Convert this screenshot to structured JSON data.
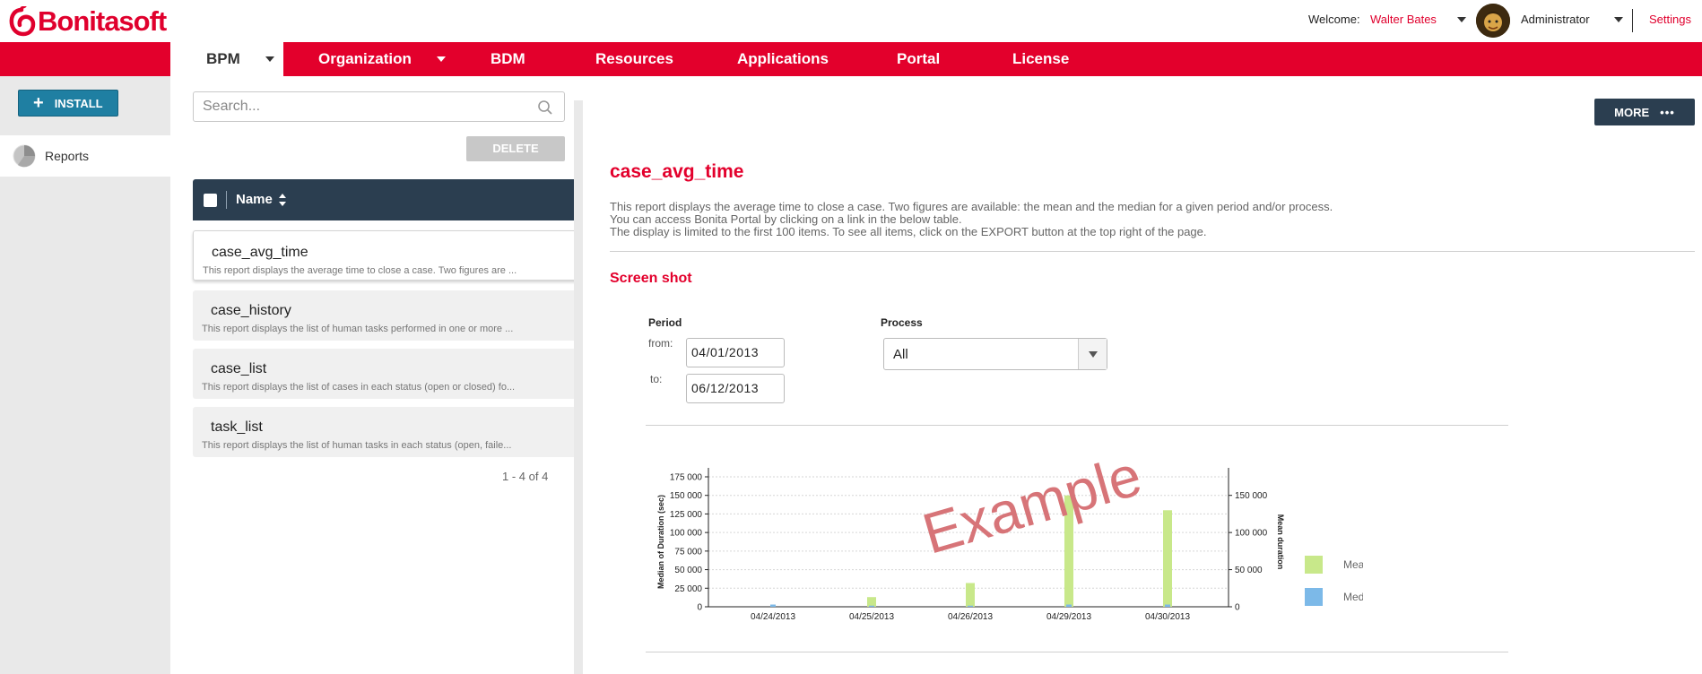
{
  "header": {
    "brand": "Bonitasoft",
    "welcome_label": "Welcome:",
    "user_name": "Walter Bates",
    "profile": "Administrator",
    "settings": "Settings"
  },
  "nav": {
    "items": [
      {
        "label": "BPM",
        "active": true,
        "dropdown": true
      },
      {
        "label": "Organization",
        "dropdown": true
      },
      {
        "label": "BDM"
      },
      {
        "label": "Resources"
      },
      {
        "label": "Applications"
      },
      {
        "label": "Portal"
      },
      {
        "label": "License"
      }
    ]
  },
  "sidebar": {
    "install_label": "INSTALL",
    "items": [
      {
        "label": "Reports",
        "icon": "pie-chart-icon"
      }
    ]
  },
  "list": {
    "search_placeholder": "Search...",
    "delete_label": "DELETE",
    "column_name": "Name",
    "rows": [
      {
        "title": "case_avg_time",
        "desc": "This report displays the average time to close a case. Two figures are ..."
      },
      {
        "title": "case_history",
        "desc": "This report displays the list of human tasks performed in one or more ..."
      },
      {
        "title": "case_list",
        "desc": "This report displays the list of cases in each status (open or closed) fo..."
      },
      {
        "title": "task_list",
        "desc": "This report displays the list of human tasks in each status (open, faile..."
      }
    ],
    "pager": "1 - 4 of 4"
  },
  "detail": {
    "more_label": "MORE",
    "title": "case_avg_time",
    "desc_lines": [
      "This report displays the average time to close a case. Two figures are available: the mean and the median for a given period and/or process.",
      "You can access Bonita Portal by clicking on a link in the below table.",
      "The display is limited to the first 100 items. To see all items, click on the EXPORT button at the top right of the page."
    ],
    "screenshot_label": "Screen shot",
    "period_label": "Period",
    "from_label": "from:",
    "from_value": "04/01/2013",
    "to_label": "to:",
    "to_value": "06/12/2013",
    "process_label": "Process",
    "process_value": "All",
    "watermark": "Example"
  },
  "chart_data": {
    "type": "bar",
    "categories": [
      "04/24/2013",
      "04/25/2013",
      "04/26/2013",
      "04/29/2013",
      "04/30/2013"
    ],
    "series": [
      {
        "name": "Mean",
        "axis": "right",
        "color": "#c8e88a",
        "values": [
          0,
          13000,
          32000,
          150000,
          130000
        ]
      },
      {
        "name": "Median",
        "axis": "left",
        "color": "#7cb9e8",
        "values": [
          3000,
          1500,
          1500,
          3000,
          3000
        ]
      }
    ],
    "ylabel": "Median of Duration (sec)",
    "y2label": "Mean duration",
    "ylim": [
      0,
      175000
    ],
    "y2lim": [
      0,
      175000
    ],
    "yticks": [
      "0",
      "25 000",
      "50 000",
      "75 000",
      "100 000",
      "125 000",
      "150 000",
      "175 000"
    ],
    "y2ticks": [
      "0",
      "50 000",
      "100 000",
      "150 000"
    ],
    "legend": "right"
  }
}
